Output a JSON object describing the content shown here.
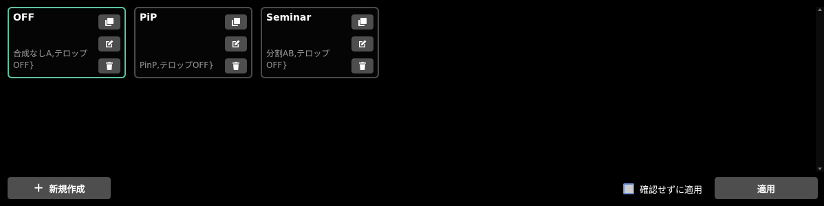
{
  "presets": [
    {
      "title": "OFF",
      "description": "合成なしA,テロップOFF}",
      "active": true
    },
    {
      "title": "PiP",
      "description": "PinP,テロップOFF}",
      "active": false
    },
    {
      "title": "Seminar",
      "description": "分割AB,テロップOFF}",
      "active": false
    }
  ],
  "icons": {
    "duplicate": "copy-icon",
    "edit": "edit-icon",
    "delete": "trash-icon"
  },
  "footer": {
    "new_label": "新規作成",
    "confirm_label": "確認せずに適用",
    "apply_label": "適用"
  },
  "colors": {
    "active_border": "#5ec3a0",
    "button_bg": "#4e4e4e"
  }
}
